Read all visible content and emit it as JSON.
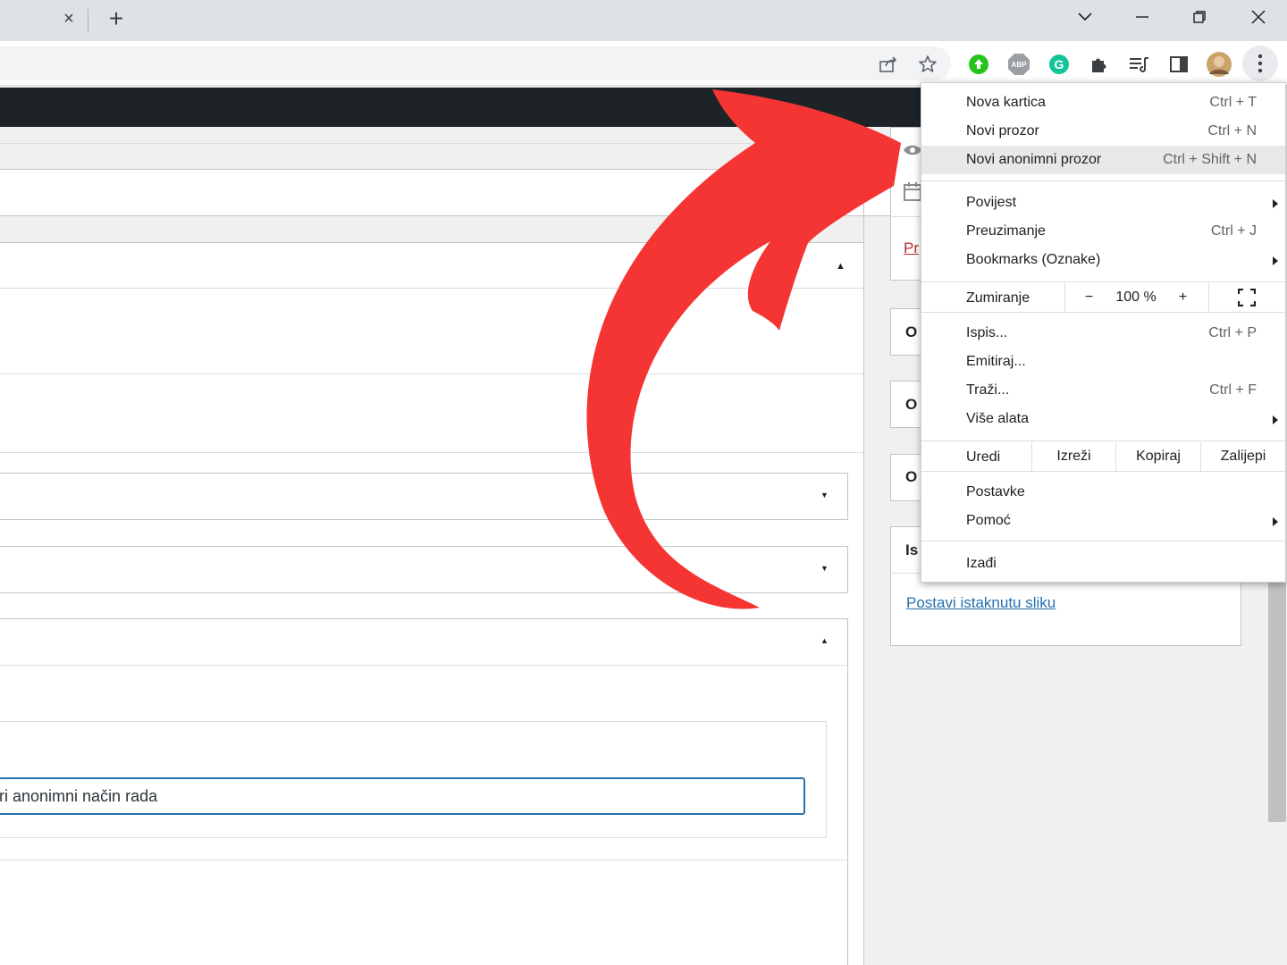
{
  "browser": {
    "tab_close_glyph": "×",
    "new_tab_glyph": "+",
    "window": {
      "tab_search_glyph": "⌄",
      "minimize_glyph": "–",
      "restore_glyph": "❐",
      "close_glyph": "✕"
    }
  },
  "editor": {
    "input_value": "ri anonimni način rada"
  },
  "sidebar": {
    "box_letters": [
      "O",
      "O",
      "O"
    ],
    "featured_title": "Is",
    "featured_link": "Postavi istaknutu sliku",
    "red_link": "Pr"
  },
  "chrome_menu": {
    "new_tab": {
      "label": "Nova kartica",
      "shortcut": "Ctrl + T"
    },
    "new_window": {
      "label": "Novi prozor",
      "shortcut": "Ctrl + N"
    },
    "new_incognito": {
      "label": "Novi anonimni prozor",
      "shortcut": "Ctrl + Shift + N"
    },
    "history": {
      "label": "Povijest"
    },
    "downloads": {
      "label": "Preuzimanje",
      "shortcut": "Ctrl + J"
    },
    "bookmarks": {
      "label": "Bookmarks (Oznake)"
    },
    "zoom": {
      "label": "Zumiranje",
      "minus": "−",
      "value": "100 %",
      "plus": "+"
    },
    "print": {
      "label": "Ispis...",
      "shortcut": "Ctrl + P"
    },
    "cast": {
      "label": "Emitiraj..."
    },
    "find": {
      "label": "Traži...",
      "shortcut": "Ctrl + F"
    },
    "more_tools": {
      "label": "Više alata"
    },
    "edit": {
      "label": "Uredi",
      "cut": "Izreži",
      "copy": "Kopiraj",
      "paste": "Zalijepi"
    },
    "settings": {
      "label": "Postavke"
    },
    "help": {
      "label": "Pomoć"
    },
    "exit": {
      "label": "Izađi"
    }
  },
  "colors": {
    "arrow": "#f53434",
    "admin_bar": "#1d2327",
    "link": "#2271b1",
    "highlight": "#e8e8e9",
    "focus_border": "#2271b1"
  },
  "icons": [
    "share-icon",
    "bookmark-star-icon",
    "green-extension-icon",
    "adblock-icon",
    "grammarly-icon",
    "extensions-puzzle-icon",
    "media-control-icon",
    "side-panel-icon",
    "profile-avatar",
    "kebab-menu-icon"
  ]
}
